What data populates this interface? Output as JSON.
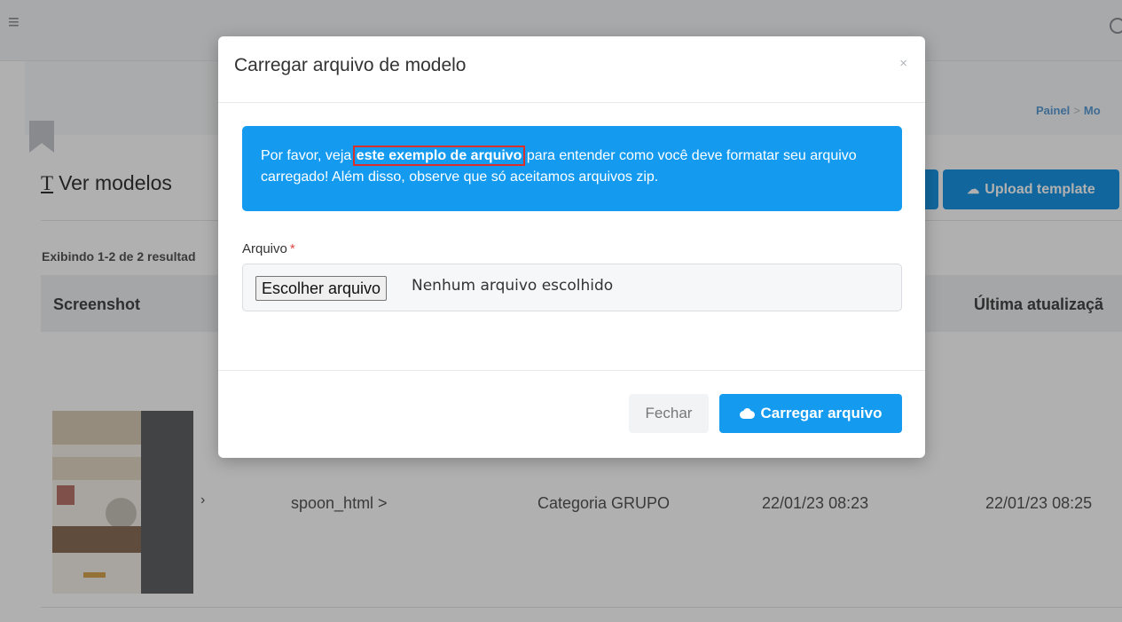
{
  "page": {
    "breadcrumb": [
      "Painel",
      "Mo"
    ],
    "title": "Ver modelos",
    "title_icon": "T",
    "upload_button_label": "Upload template",
    "results_text": "Exibindo 1-2 de 2 resultad",
    "table": {
      "columns": [
        "Screenshot",
        "Última atualizaçã"
      ],
      "rows": [
        {
          "name": "spoon_html >",
          "category": "Categoria GRUPO",
          "created": "22/01/23 08:23",
          "updated": "22/01/23 08:25"
        }
      ]
    }
  },
  "modal": {
    "title": "Carregar arquivo de modelo",
    "close_symbol": "×",
    "alert": {
      "text_before": "Por favor, veja ",
      "link_text": "este exemplo de arquivo",
      "text_after": " para entender como você deve formatar seu arquivo carregado! Além disso, observe que só aceitamos arquivos zip."
    },
    "field_label": "Arquivo",
    "required_mark": "*",
    "file_button_label": "Escolher arquivo",
    "file_status": "Nenhum arquivo escolhido",
    "close_button_label": "Fechar",
    "submit_button_label": "Carregar arquivo"
  },
  "icons": {
    "menu": "hamburger-icon",
    "upload": "cloud-upload-icon",
    "close": "close-icon"
  },
  "colors": {
    "primary": "#149bf0",
    "required": "#e04747",
    "highlight_border": "#d9302c"
  }
}
